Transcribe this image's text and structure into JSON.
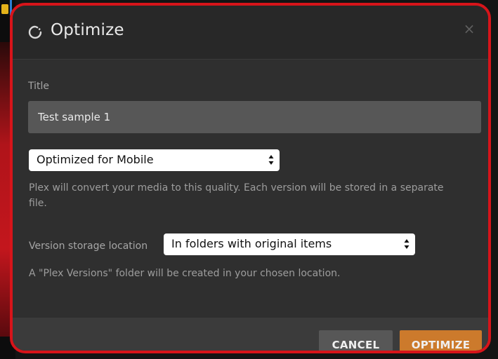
{
  "dialog": {
    "title": "Optimize",
    "close_glyph": "×",
    "icon": "loading-spinner-icon"
  },
  "form": {
    "title_label": "Title",
    "title_value": "Test sample 1",
    "quality_select": {
      "selected": "Optimized for Mobile"
    },
    "quality_hint": "Plex will convert your media to this quality. Each version will be stored in a separate file.",
    "storage_label": "Version storage location",
    "storage_select": {
      "selected": "In folders with original items"
    },
    "storage_hint": "A \"Plex Versions\" folder will be created in your chosen location."
  },
  "footer": {
    "cancel_label": "CANCEL",
    "optimize_label": "OPTIMIZE"
  },
  "colors": {
    "primary_accent": "#cc7a2c",
    "highlight_border": "#d7141a",
    "dialog_background": "#2f2f2f"
  }
}
